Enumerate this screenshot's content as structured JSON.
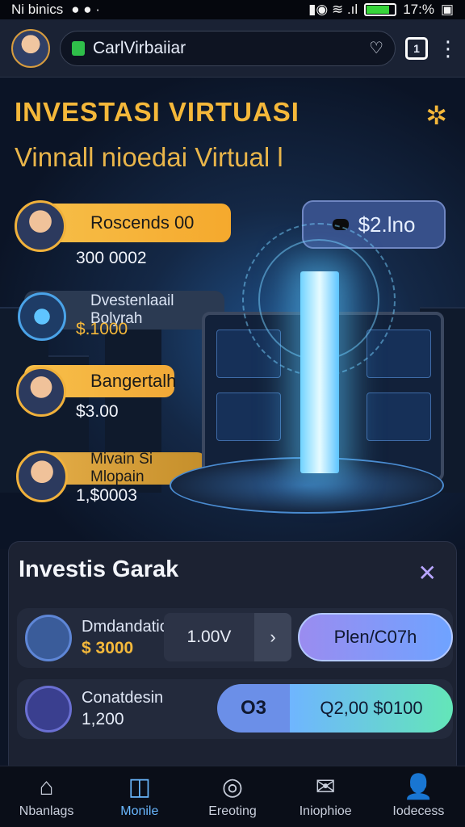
{
  "status": {
    "left_text": "Ni binics",
    "right_text": "17:%"
  },
  "topbar": {
    "url_text": "CarlVirbaiiar",
    "tab_count": "1"
  },
  "hero": {
    "title": "INVESTASI VIRTUASI",
    "subtitle": "Vinnall nioedai Virtual l",
    "price_chip": "$2.lno",
    "investors": [
      {
        "name": "Roscends 00",
        "amount": "300 0002"
      },
      {
        "name": "Dvestenlaail Bolyrah",
        "amount": "$.1000"
      },
      {
        "name": "Bangertalh",
        "amount": "$3.00"
      },
      {
        "name": "Mivain Si Mlopain",
        "amount": "1,$0003"
      }
    ]
  },
  "section": {
    "title": "Investis Garak",
    "rows": [
      {
        "name": "Dmdandation",
        "amount": "$ 3000",
        "qty": "1.00V",
        "button": "Plen/C07h"
      },
      {
        "name": "Conatdesin",
        "amount": "1,200",
        "toggle": "O3",
        "button": "Q2,00 $0100"
      }
    ]
  },
  "nav": {
    "items": [
      {
        "label": "Nbanlags"
      },
      {
        "label": "Monile"
      },
      {
        "label": "Ereoting"
      },
      {
        "label": "Iniophioe"
      },
      {
        "label": "Iodecess"
      }
    ]
  },
  "colors": {
    "accent_gold": "#f5b83a",
    "accent_blue": "#6ab8ff",
    "background": "#0d1526"
  }
}
